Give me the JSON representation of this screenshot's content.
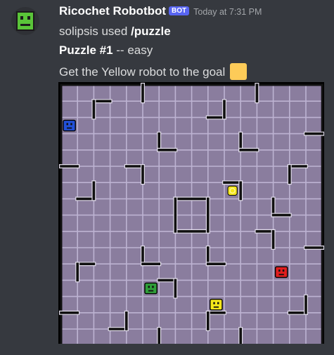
{
  "message": {
    "author": "Ricochet Robotbot",
    "bot_tag": "BOT",
    "timestamp": "Today at 7:31 PM",
    "command_user": "solipsis used ",
    "command": "/puzzle",
    "puzzle_title": "Puzzle #1",
    "difficulty": " -- easy",
    "instruction": "Get the Yellow robot to the goal",
    "goal_icon": "yellow-square-emoji"
  },
  "board": {
    "rows": 16,
    "cols": 16,
    "colors": {
      "background": "#8a7d9e",
      "gridline": "#bdb3d2",
      "wall": "#111111",
      "red": "#e01e1e",
      "green": "#2f9e3a",
      "blue": "#2250d8",
      "yellow": "#f5e71a",
      "goal": "#f5e71a"
    },
    "robots": [
      {
        "color": "blue",
        "row": 2,
        "col": 0
      },
      {
        "color": "red",
        "row": 11,
        "col": 13
      },
      {
        "color": "green",
        "row": 12,
        "col": 5
      },
      {
        "color": "yellow",
        "row": 13,
        "col": 9
      }
    ],
    "goal": {
      "color": "yellow",
      "row": 6,
      "col": 10
    }
  }
}
